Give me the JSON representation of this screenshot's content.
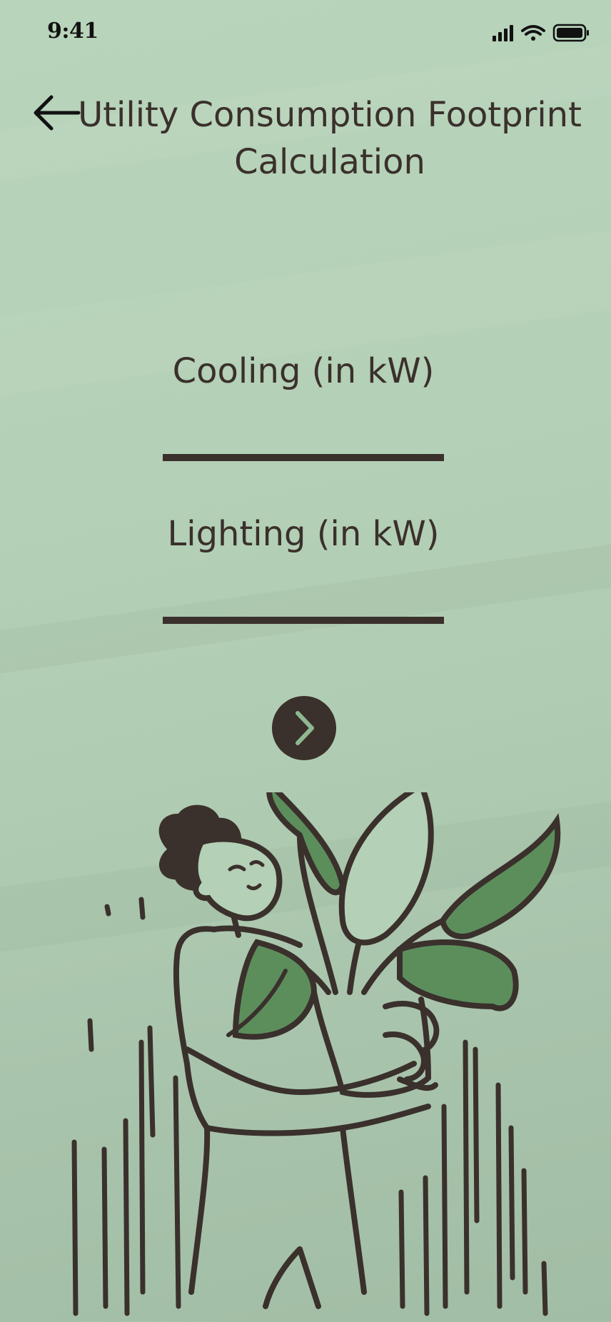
{
  "status_bar": {
    "time": "9:41",
    "icons": [
      "signal-icon",
      "wifi-icon",
      "battery-icon"
    ]
  },
  "header": {
    "back_icon": "arrow-left-icon",
    "title": "Utility Consumption Footprint Calculation"
  },
  "form": {
    "fields": [
      {
        "label": "Cooling (in kW)",
        "value": ""
      },
      {
        "label": "Lighting (in kW)",
        "value": ""
      }
    ],
    "next_icon": "chevron-right-icon"
  },
  "illustration": {
    "subject": "person-holding-plant-illustration"
  },
  "colors": {
    "background": "#b4d0b6",
    "ink": "#3a302c",
    "leaf": "#5c8e5c",
    "accent_icon": "#8fb88f"
  }
}
